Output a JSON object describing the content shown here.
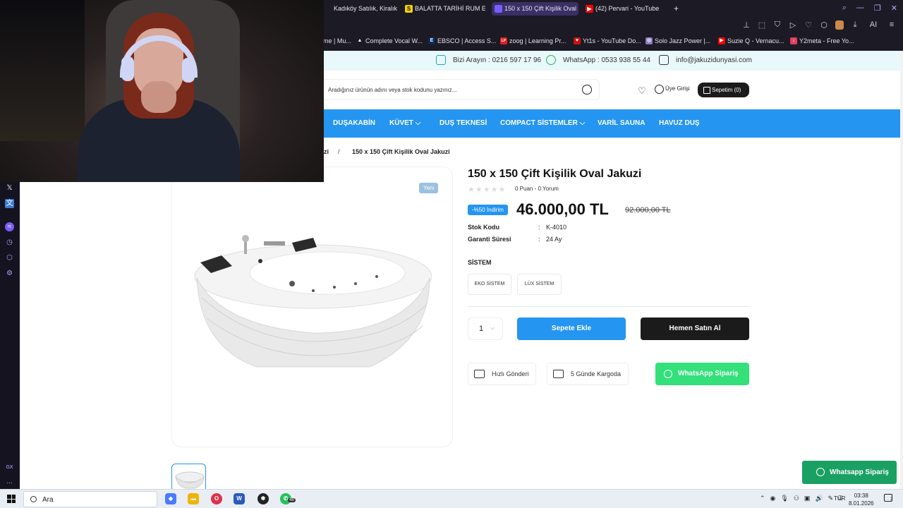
{
  "browser": {
    "tabs": [
      {
        "label": "Kadıköy Satılık, Kiralık Em",
        "icon": "",
        "icon_color": "#1c1a24",
        "active": false
      },
      {
        "label": "BALATTA TARİHİ RUM EVİ",
        "icon": "S",
        "icon_color": "#f5d000",
        "active": false
      },
      {
        "label": "150 x 150 Çift Kişilik Oval",
        "icon": "",
        "icon_color": "#7a5cff",
        "active": true
      },
      {
        "label": "(42) Pervari - YouTube",
        "icon": "▶",
        "icon_color": "#ff0000",
        "active": false
      }
    ],
    "new_tab": "+",
    "bookmarks": [
      {
        "label": "me | Mu...",
        "icon": "",
        "color": "#1c1a24"
      },
      {
        "label": "Complete Vocal W...",
        "icon": "▲",
        "color": "#1c1a24"
      },
      {
        "label": "EBSCO | Access S...",
        "icon": "E",
        "color": "#0b2a5b"
      },
      {
        "label": "zoog | Learning Pr...",
        "icon": "LP",
        "color": "#e02020"
      },
      {
        "label": "Yt1s - YouTube Do...",
        "icon": "♥",
        "color": "#cc1010"
      },
      {
        "label": "Solo Jazz Power |...",
        "icon": "◎",
        "color": "#8c7cc0"
      },
      {
        "label": "Suzie Q - Vernacu...",
        "icon": "▶",
        "color": "#ff0000"
      },
      {
        "label": "Y2meta - Free Yo...",
        "icon": "↓",
        "color": "#e04060"
      }
    ],
    "toolbar_ai": "AI"
  },
  "site": {
    "topbar": {
      "phone": "Bizi Arayın : 0216 597 17 96",
      "whatsapp": "WhatsApp : 0533 938 55 44",
      "email": "info@jakuzidunyasi.com"
    },
    "search_placeholder": "Aradığınız ürünün adını veya stok kodunu yazınız...",
    "login": "Üye Girişi",
    "cart": "Sepetim (0)",
    "nav": [
      "DUŞAKABİN",
      "KÜVET",
      "DUŞ TEKNESİ",
      "COMPACT SİSTEMLER",
      "VARİL SAUNA",
      "HAVUZ DUŞ"
    ],
    "nav_chevron": "⌵",
    "breadcrumb": {
      "prev": "zi",
      "sep": "/",
      "current": "150 x 150 Çift Kişilik Oval Jakuzi"
    },
    "badge_new": "Yeni"
  },
  "product": {
    "title": "150 x 150 Çift Kişilik Oval Jakuzi",
    "stars": "★★★★★",
    "rating_text": "0 Puan - 0 Yorum",
    "discount": "-%50 İndirim",
    "price": "46.000,00 TL",
    "old_price": "92.000,00 TL",
    "specs": [
      {
        "key": "Stok Kodu",
        "sep": ":",
        "value": "K-4010"
      },
      {
        "key": "Garanti Süresi",
        "sep": ":",
        "value": "24 Ay"
      }
    ],
    "system_label": "SİSTEM",
    "options": [
      "EKO SİSTEM",
      "LÜX SİSTEM"
    ],
    "quantity": "1",
    "add_to_cart": "Sepete Ekle",
    "buy_now": "Hemen Satın Al",
    "features": [
      "Hızlı Gönderi",
      "5 Günde Kargoda"
    ],
    "whatsapp_order": "WhatsApp Sipariş",
    "whatsapp_float": "Whatsapp Sipariş"
  },
  "sidebar_gx": {
    "gx_label": "GX",
    "more": "..."
  },
  "taskbar": {
    "search": "Ara",
    "apps": [
      {
        "name": "copilot",
        "icon": "◆",
        "color": "#4a7bff"
      },
      {
        "name": "file-explorer",
        "icon": "▬",
        "color": "#f0b400"
      },
      {
        "name": "opera",
        "icon": "O",
        "color": "#e0304a"
      },
      {
        "name": "word",
        "icon": "W",
        "color": "#2b5bc0"
      },
      {
        "name": "app-dark",
        "icon": "✱",
        "color": "#222222"
      },
      {
        "name": "whatsapp",
        "icon": "✆",
        "color": "#25c25a"
      }
    ],
    "whatsapp_badge": "48",
    "lang": "TUR",
    "time": "03:38",
    "date": "8.01.2026",
    "notif_count": "3"
  }
}
